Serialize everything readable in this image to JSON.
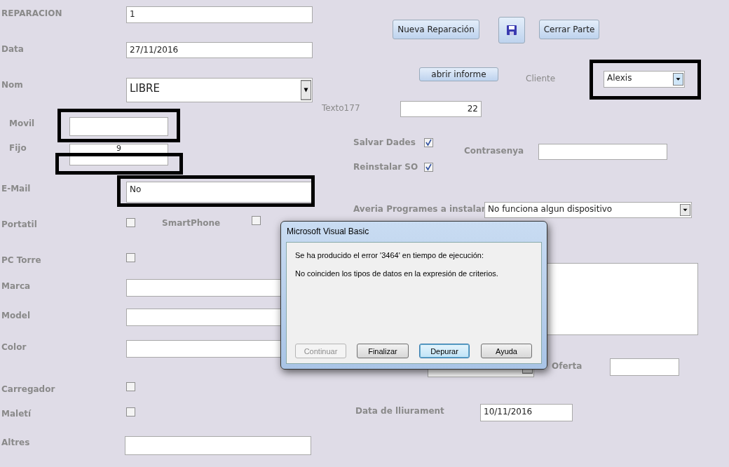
{
  "form": {
    "buttons": [
      {
        "kind": "text",
        "label": "Nueva Reparación"
      },
      {
        "kind": "save"
      },
      {
        "kind": "text",
        "label": "Cerrar Parte"
      },
      {
        "kind": "text",
        "label": "abrir informe"
      }
    ],
    "fields": [
      {
        "label": "REPARACION",
        "bold": true,
        "kind": "text",
        "value": "1"
      },
      {
        "label": "Data",
        "bold": true,
        "kind": "text",
        "value": "27/11/2016"
      },
      {
        "label": "Nom",
        "bold": true,
        "kind": "combo",
        "value": "LIBRE"
      },
      {
        "label": "Cliente",
        "bold": false,
        "kind": "combo",
        "value": "Alexis",
        "highlighted": true
      },
      {
        "label": "Texto177",
        "bold": false,
        "kind": "number",
        "value": "22"
      },
      {
        "label": "Movil",
        "bold": true,
        "kind": "text",
        "highlighted": true
      },
      {
        "label": "Salvar Dades",
        "bold": true,
        "kind": "checkbox",
        "checked": true
      },
      {
        "label": "Fijo",
        "bold": true,
        "kind": "text",
        "value": "9",
        "highlighted": true
      },
      {
        "label": "Contrasenya",
        "bold": true,
        "kind": "text"
      },
      {
        "label": "Reinstalar SO",
        "bold": true,
        "kind": "checkbox",
        "checked": true
      },
      {
        "label": "E-Mail",
        "bold": true,
        "kind": "text",
        "value": "No",
        "highlighted": true
      },
      {
        "label": "Averia Programes a instalar",
        "bold": true,
        "kind": "combo",
        "value": "No funciona algun dispositivo"
      },
      {
        "label": "Portatil",
        "bold": true,
        "kind": "checkbox",
        "checked": false
      },
      {
        "label": "SmartPhone",
        "bold": true,
        "kind": "checkbox",
        "checked": false
      },
      {
        "label": "PC Torre",
        "bold": true,
        "kind": "checkbox",
        "checked": false
      },
      {
        "kind": "memo"
      },
      {
        "label": "Marca",
        "bold": true,
        "kind": "text"
      },
      {
        "label": "Model",
        "bold": true,
        "kind": "text"
      },
      {
        "label": "Color",
        "bold": true,
        "kind": "text"
      },
      {
        "kind": "combo"
      },
      {
        "label": "Oferta",
        "bold": true,
        "kind": "text"
      },
      {
        "label": "Carregador",
        "bold": true,
        "kind": "checkbox",
        "checked": false
      },
      {
        "label": "Maletí",
        "bold": true,
        "kind": "checkbox",
        "checked": false
      },
      {
        "label": "Data de lliurament",
        "bold": true,
        "kind": "text",
        "value": "10/11/2016"
      },
      {
        "label": "Altres",
        "bold": true,
        "kind": "text"
      }
    ]
  },
  "dialog": {
    "title": "Microsoft Visual Basic",
    "lines": [
      "Se ha producido el error '3464' en tiempo de ejecución:",
      "No coinciden los tipos de datos en la expresión de criterios."
    ],
    "buttons": [
      {
        "label": "Continuar",
        "disabled": true,
        "focused": false
      },
      {
        "label": "Finalizar",
        "disabled": false,
        "focused": false
      },
      {
        "label": "Depurar",
        "disabled": false,
        "focused": true
      },
      {
        "label": "Ayuda",
        "disabled": false,
        "focused": false
      }
    ]
  }
}
